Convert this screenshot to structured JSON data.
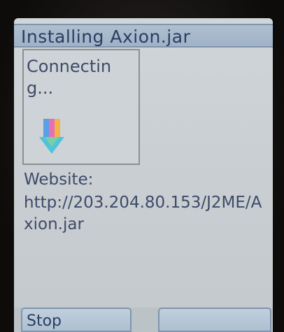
{
  "title_bar": {
    "title": "Installing Axion.jar"
  },
  "progress_box": {
    "status_text": "Connecting...",
    "icon": "download-arrow-icon"
  },
  "info": {
    "website_label": "Website:",
    "website_url": "http://203.204.80.153/J2ME/Axion.jar"
  },
  "softkeys": {
    "left_label": "Stop",
    "right_label": ""
  },
  "colors": {
    "title_bar_bg": "#9fb2c6",
    "screen_bg": "#c9cfd2",
    "text": "#3f4a6a"
  }
}
